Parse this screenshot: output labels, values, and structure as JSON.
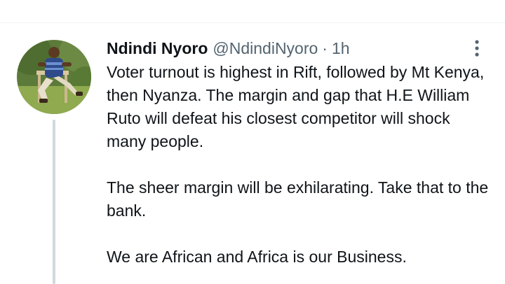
{
  "tweet": {
    "author": {
      "display_name": "Ndindi Nyoro",
      "handle": "@NdindiNyoro"
    },
    "separator": "·",
    "timestamp": "1h",
    "paragraphs": [
      "Voter turnout is highest in Rift, followed by Mt Kenya, then Nyanza. The margin and gap that H.E William Ruto will defeat his closest competitor will shock many people.",
      "The sheer margin will be exhilarating. Take that to the bank.",
      "We are African and Africa is our Business."
    ],
    "more_icon": "more-vertical-icon"
  },
  "colors": {
    "text_primary": "#0f1419",
    "text_secondary": "#536471",
    "thread_line": "#cfd9de",
    "divider": "#eff3f4"
  }
}
